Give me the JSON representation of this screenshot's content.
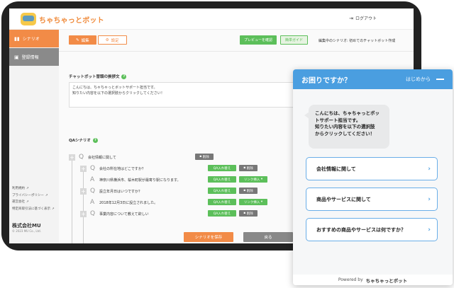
{
  "header": {
    "logo_text": "ちゃちゃっとボット",
    "logout": "ログアウト"
  },
  "sidebar": {
    "items": [
      {
        "label": "シナリオ",
        "icon": "book-icon"
      },
      {
        "label": "登録情報",
        "icon": "id-card-icon"
      }
    ],
    "links": [
      "利用規約",
      "プライバシーポリシー",
      "運営会社",
      "特定商取引法に基づく表示"
    ],
    "company": "株式会社MU",
    "copyright": "© 2023 MU Co., Ltd."
  },
  "toolbar": {
    "edit_tab": "編集",
    "settings_tab": "設定",
    "preview": "プレビューを確認",
    "guide": "簡単ガイド",
    "editing": "編集中のシナリオ: 初めてのチャットボット作成"
  },
  "greeting": {
    "label": "チャットボット冒頭の挨拶文",
    "text_line1": "こんにちは、ちゃちゃっとボットサポート担当です。",
    "text_line2": "知りたい内容を以下の選択肢からクリックしてください！"
  },
  "qa": {
    "label": "QAシナリオ",
    "rows": [
      {
        "type": "Q",
        "text": "会社情報に関して"
      },
      {
        "type": "Q",
        "text": "会社の所在地はどこですか？"
      },
      {
        "type": "A",
        "text": "神奈川県横浜市、桜木町駅が最寄り駅になります。"
      },
      {
        "type": "Q",
        "text": "設立年月日はいつですか？"
      },
      {
        "type": "A",
        "text": "2018年12月3日に設立されました。"
      },
      {
        "type": "Q",
        "text": "事業内容について教えて欲しい"
      }
    ],
    "delete": "削除",
    "qa_swap": "QA入れ替え",
    "link_insert": "リンク挿入"
  },
  "footer": {
    "save": "シナリオを保存",
    "back": "戻る"
  },
  "widget": {
    "title": "お困りですか？",
    "restart": "はじめから",
    "bubble_line1": "こんにちは、ちゃちゃっとボッ",
    "bubble_line2": "トサポート担当です。",
    "bubble_line3": "知りたい内容を以下の選択肢",
    "bubble_line4": "からクリックしてください！",
    "choices": [
      "会社情報に関して",
      "商品やサービスに関して",
      "おすすめの商品やサービスは何ですか？"
    ],
    "powered_by": "Powered by",
    "brand": "ちゃちゃっとボット"
  },
  "colors": {
    "accent_orange": "#f28b47",
    "green": "#5cbf5a",
    "widget_blue": "#4a9ee0"
  }
}
